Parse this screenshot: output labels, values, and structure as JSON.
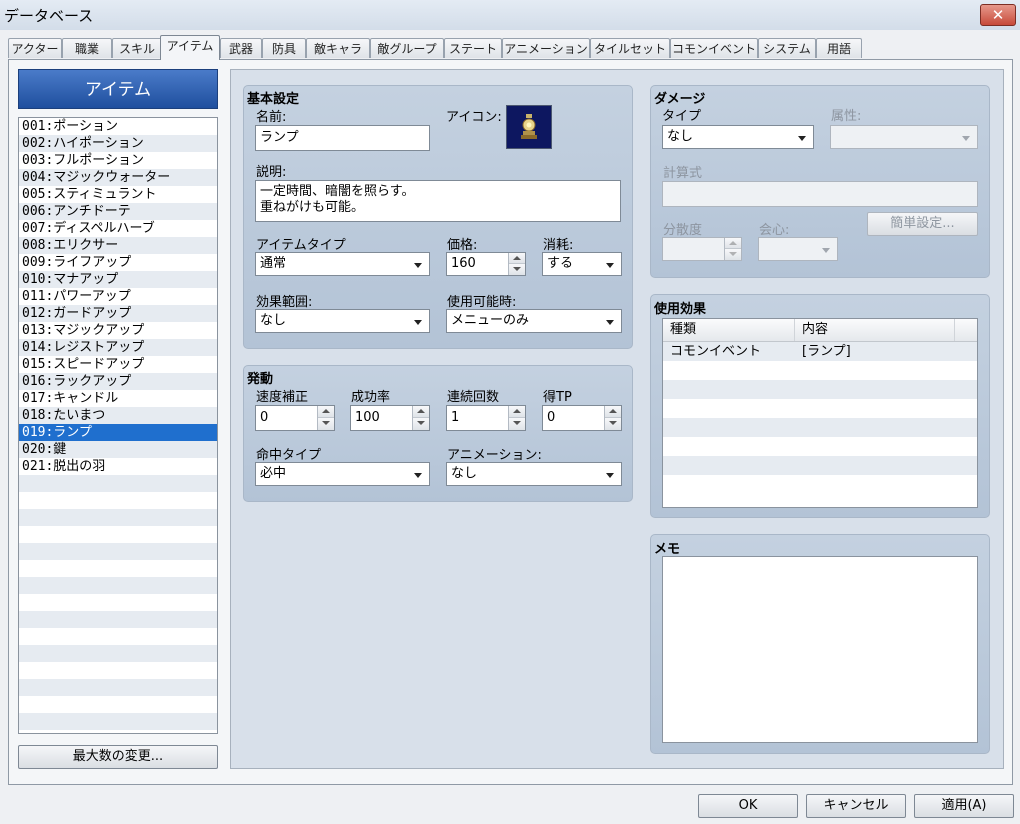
{
  "window": {
    "title": "データベース",
    "close_symbol": "✕"
  },
  "tabs": [
    "アクター",
    "職業",
    "スキル",
    "アイテム",
    "武器",
    "防具",
    "敵キャラ",
    "敵グループ",
    "ステート",
    "アニメーション",
    "タイルセット",
    "コモンイベント",
    "システム",
    "用語"
  ],
  "active_tab": "アイテム",
  "item_list": {
    "header": "アイテム",
    "items": [
      "001:ポーション",
      "002:ハイポーション",
      "003:フルポーション",
      "004:マジックウォーター",
      "005:スティミュラント",
      "006:アンチドーテ",
      "007:ディスペルハーブ",
      "008:エリクサー",
      "009:ライフアップ",
      "010:マナアップ",
      "011:パワーアップ",
      "012:ガードアップ",
      "013:マジックアップ",
      "014:レジストアップ",
      "015:スピードアップ",
      "016:ラックアップ",
      "017:キャンドル",
      "018:たいまつ",
      "019:ランプ",
      "020:鍵",
      "021:脱出の羽"
    ],
    "selected": "019:ランプ",
    "change_max_button": "最大数の変更..."
  },
  "basic": {
    "title": "基本設定",
    "name_label": "名前:",
    "name_value": "ランプ",
    "icon_label": "アイコン:",
    "description_label": "説明:",
    "description_line1": "一定時間、暗闇を照らす。",
    "description_line2": "重ねがけも可能。",
    "item_type_label": "アイテムタイプ",
    "item_type_value": "通常",
    "price_label": "価格:",
    "price_value": "160",
    "consume_label": "消耗:",
    "consume_value": "する",
    "scope_label": "効果範囲:",
    "scope_value": "なし",
    "occasion_label": "使用可能時:",
    "occasion_value": "メニューのみ"
  },
  "invocation": {
    "title": "発動",
    "speed_label": "速度補正",
    "speed_value": "0",
    "success_label": "成功率",
    "success_value": "100",
    "repeats_label": "連続回数",
    "repeats_value": "1",
    "tp_label": "得TP",
    "tp_value": "0",
    "hit_type_label": "命中タイプ",
    "hit_type_value": "必中",
    "animation_label": "アニメーション:",
    "animation_value": "なし"
  },
  "damage": {
    "title": "ダメージ",
    "type_label": "タイプ",
    "type_value": "なし",
    "element_label": "属性:",
    "formula_label": "計算式",
    "variance_label": "分散度",
    "critical_label": "会心:",
    "quick_setup_button": "簡単設定..."
  },
  "effects": {
    "title": "使用効果",
    "columns": [
      "種類",
      "内容"
    ],
    "rows": [
      [
        "コモンイベント",
        "[ランプ]"
      ]
    ]
  },
  "memo": {
    "title": "メモ"
  },
  "footer": {
    "ok": "OK",
    "cancel": "キャンセル",
    "apply": "適用(A)"
  }
}
